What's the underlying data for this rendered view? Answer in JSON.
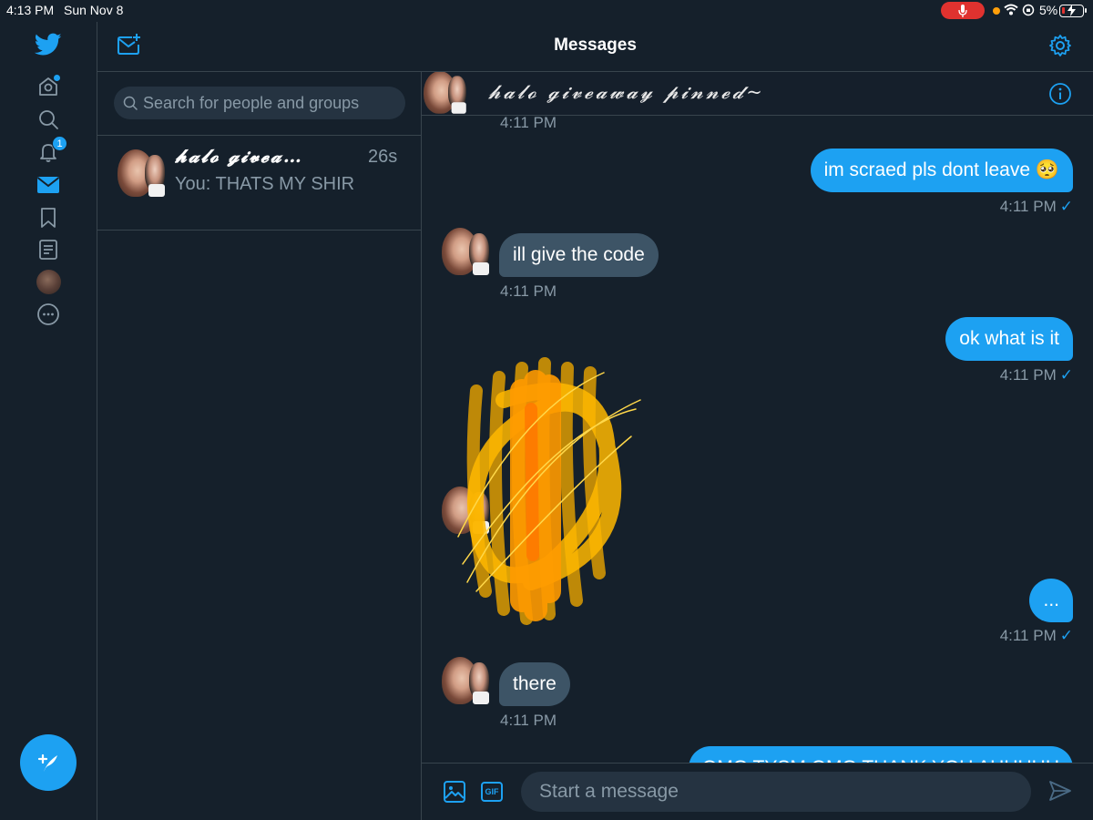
{
  "status_bar": {
    "time": "4:13 PM",
    "date": "Sun Nov 8",
    "battery_percent": "5%",
    "battery_level": 0.05
  },
  "nav": {
    "items": [
      "twitter-logo",
      "home",
      "explore",
      "notifications",
      "messages",
      "bookmarks",
      "lists",
      "profile",
      "more"
    ],
    "notifications_badge": "1",
    "active": "messages",
    "compose_tweet": "compose-tweet"
  },
  "header": {
    "title": "Messages"
  },
  "search": {
    "placeholder": "Search for people and groups"
  },
  "conversations": [
    {
      "name": "𝓱𝓪𝓵𝓸 𝓰𝓲𝓿𝓮𝓪…",
      "time": "26s",
      "preview": "You: THATS MY SHIR"
    }
  ],
  "chat": {
    "title": "𝓱𝓪𝓵𝓸 𝓰𝓲𝓿𝓮𝓪𝔀𝓪𝔂 𝓹𝓲𝓷𝓷𝓮𝓭~",
    "messages": [
      {
        "direction": "in",
        "text": "",
        "time": "4:11 PM"
      },
      {
        "direction": "out",
        "text": "im scraed pls dont leave 🥺",
        "time": "4:11 PM",
        "check": "✓"
      },
      {
        "direction": "in",
        "text": "ill give the code",
        "time": "4:11 PM"
      },
      {
        "direction": "out",
        "text": "ok what is it",
        "time": "4:11 PM",
        "check": "✓"
      },
      {
        "direction": "in",
        "text": "[scribbled out]",
        "time": ""
      },
      {
        "direction": "out",
        "text": "...",
        "time": "4:11 PM",
        "check": "✓"
      },
      {
        "direction": "in",
        "text": "there",
        "time": "4:11 PM"
      },
      {
        "direction": "out",
        "text": "OMG TYSM OMG THANK YOU AHHHHH",
        "time": ""
      }
    ]
  },
  "composer": {
    "placeholder": "Start a message",
    "gif_label": "GIF"
  },
  "colors": {
    "background": "#15202b",
    "accent": "#1da1f2",
    "incoming_bubble": "#3d5466",
    "muted_text": "#8899a6",
    "divider": "#38444d",
    "scribble": "#ffb800"
  }
}
